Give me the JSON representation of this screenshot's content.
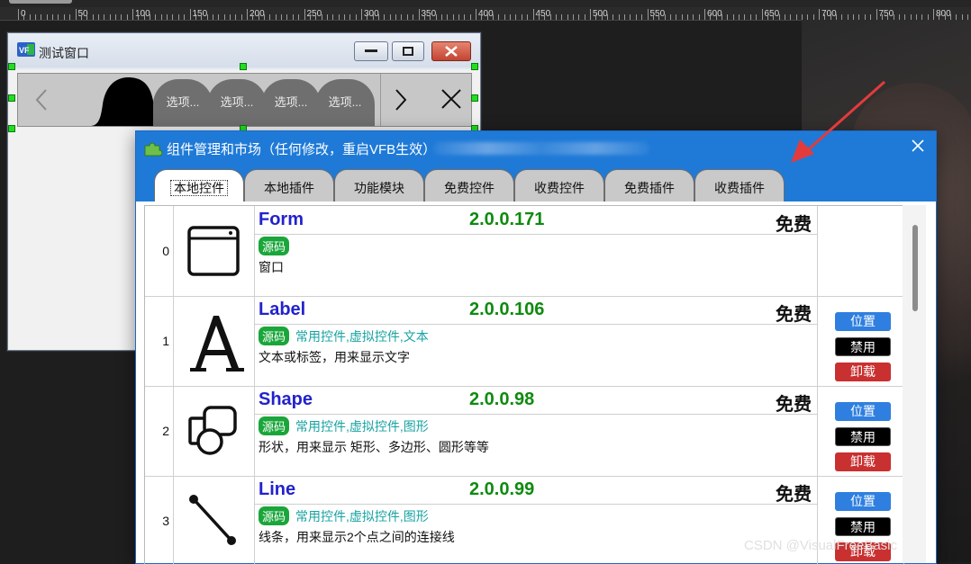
{
  "ruler": {
    "labels": [
      "0",
      "50",
      "100",
      "150",
      "200",
      "250",
      "300",
      "350",
      "400",
      "450",
      "500",
      "550",
      "600",
      "650",
      "700",
      "750",
      "800"
    ]
  },
  "test_window": {
    "app_icon_text": "VF",
    "title": "测试窗口",
    "tabs": [
      "选项...",
      "选项...",
      "选项...",
      "选项..."
    ]
  },
  "dialog": {
    "title": "组件管理和市场（任何修改，重启VFB生效）",
    "tabs": [
      "本地控件",
      "本地插件",
      "功能模块",
      "免费控件",
      "收费控件",
      "免费插件",
      "收费插件"
    ],
    "active_tab": "本地控件",
    "rows": [
      {
        "index": "0",
        "icon": "form-window-icon",
        "name": "Form",
        "version": "2.0.0.171",
        "price": "免费",
        "source_badge": "源码",
        "tags": "",
        "desc": "窗口",
        "actions": []
      },
      {
        "index": "1",
        "icon": "letter-a-icon",
        "name": "Label",
        "version": "2.0.0.106",
        "price": "免费",
        "source_badge": "源码",
        "tags": "常用控件,虚拟控件,文本",
        "desc": "文本或标签，用来显示文字",
        "actions": [
          "位置",
          "禁用",
          "卸载"
        ]
      },
      {
        "index": "2",
        "icon": "shapes-icon",
        "name": "Shape",
        "version": "2.0.0.98",
        "price": "免费",
        "source_badge": "源码",
        "tags": "常用控件,虚拟控件,图形",
        "desc": "形状，用来显示 矩形、多边形、圆形等等",
        "actions": [
          "位置",
          "禁用",
          "卸载"
        ]
      },
      {
        "index": "3",
        "icon": "line-icon",
        "name": "Line",
        "version": "2.0.0.99",
        "price": "免费",
        "source_badge": "源码",
        "tags": "常用控件,虚拟控件,图形",
        "desc": "线条，用来显示2个点之间的连接线",
        "actions": [
          "位置",
          "禁用",
          "卸载"
        ]
      }
    ]
  },
  "watermark": "CSDN @VisualFreeBasic",
  "colors": {
    "dialog_blue": "#1f7ad7",
    "name_blue": "#2222cc",
    "version_green": "#0f8a0f",
    "tag_teal": "#17a2a2",
    "badge_green": "#1aa63a",
    "btn_blue": "#2f7fe0",
    "btn_red": "#c93030",
    "arrow_red": "#e33b3b"
  }
}
